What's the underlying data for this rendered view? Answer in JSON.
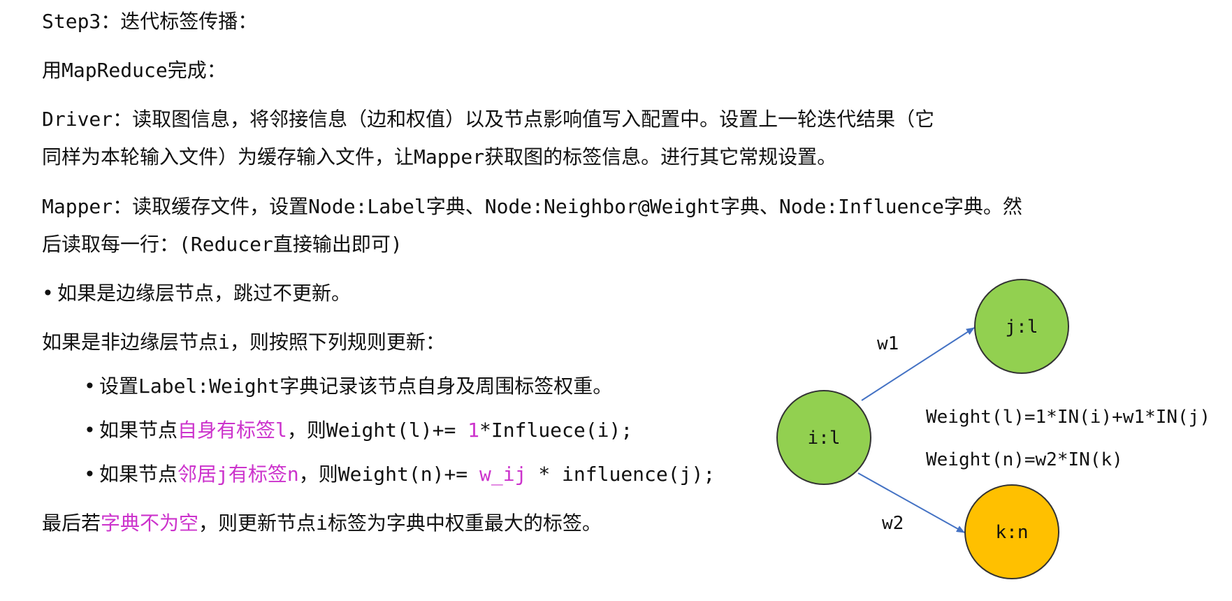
{
  "lines": {
    "step": "Step3：迭代标签传播：",
    "mapreduce": "用MapReduce完成：",
    "driver_1": "Driver：读取图信息，将邻接信息（边和权值）以及节点影响值写入配置中。设置上一轮迭代结果（它",
    "driver_2": "同样为本轮输入文件）为缓存输入文件，让Mapper获取图的标签信息。进行其它常规设置。",
    "mapper_1": "Mapper：读取缓存文件，设置Node:Label字典、Node:Neighbor@Weight字典、Node:Influence字典。然",
    "mapper_2": "后读取每一行：(Reducer直接输出即可)",
    "bullet_edge": "如果是边缘层节点，跳过不更新。",
    "nonedge": "如果是非边缘层节点i，则按照下列规则更新：",
    "sub1": "设置Label:Weight字典记录该节点自身及周围标签权重。",
    "sub2_a": "如果节点",
    "sub2_hl1": "自身有标签l",
    "sub2_b": "，则Weight(l)+= ",
    "sub2_hl2": "1",
    "sub2_c": "*Influece(i);",
    "sub3_a": "如果节点",
    "sub3_hl1": "邻居j有标签n",
    "sub3_b": "，则Weight(n)+= ",
    "sub3_hl2": "w_ij",
    "sub3_c": " * influence(j);",
    "final_a": "最后若",
    "final_hl": "字典不为空",
    "final_b": "，则更新节点i标签为字典中权重最大的标签。"
  },
  "bullet_char": "•",
  "diagram": {
    "nodes": {
      "i": {
        "label": "i:l",
        "color": "#92d050"
      },
      "j": {
        "label": "j:l",
        "color": "#92d050"
      },
      "k": {
        "label": "k:n",
        "color": "#ffc000"
      }
    },
    "edges": {
      "ij": {
        "label": "w1"
      },
      "ik": {
        "label": "w2"
      }
    },
    "formulas": {
      "f1": "Weight(l)=1*IN(i)+w1*IN(j)",
      "f2": "Weight(n)=w2*IN(k)"
    },
    "edge_color": "#4472c4",
    "node_stroke": "#333333"
  },
  "highlight_color": "#cc33cc"
}
